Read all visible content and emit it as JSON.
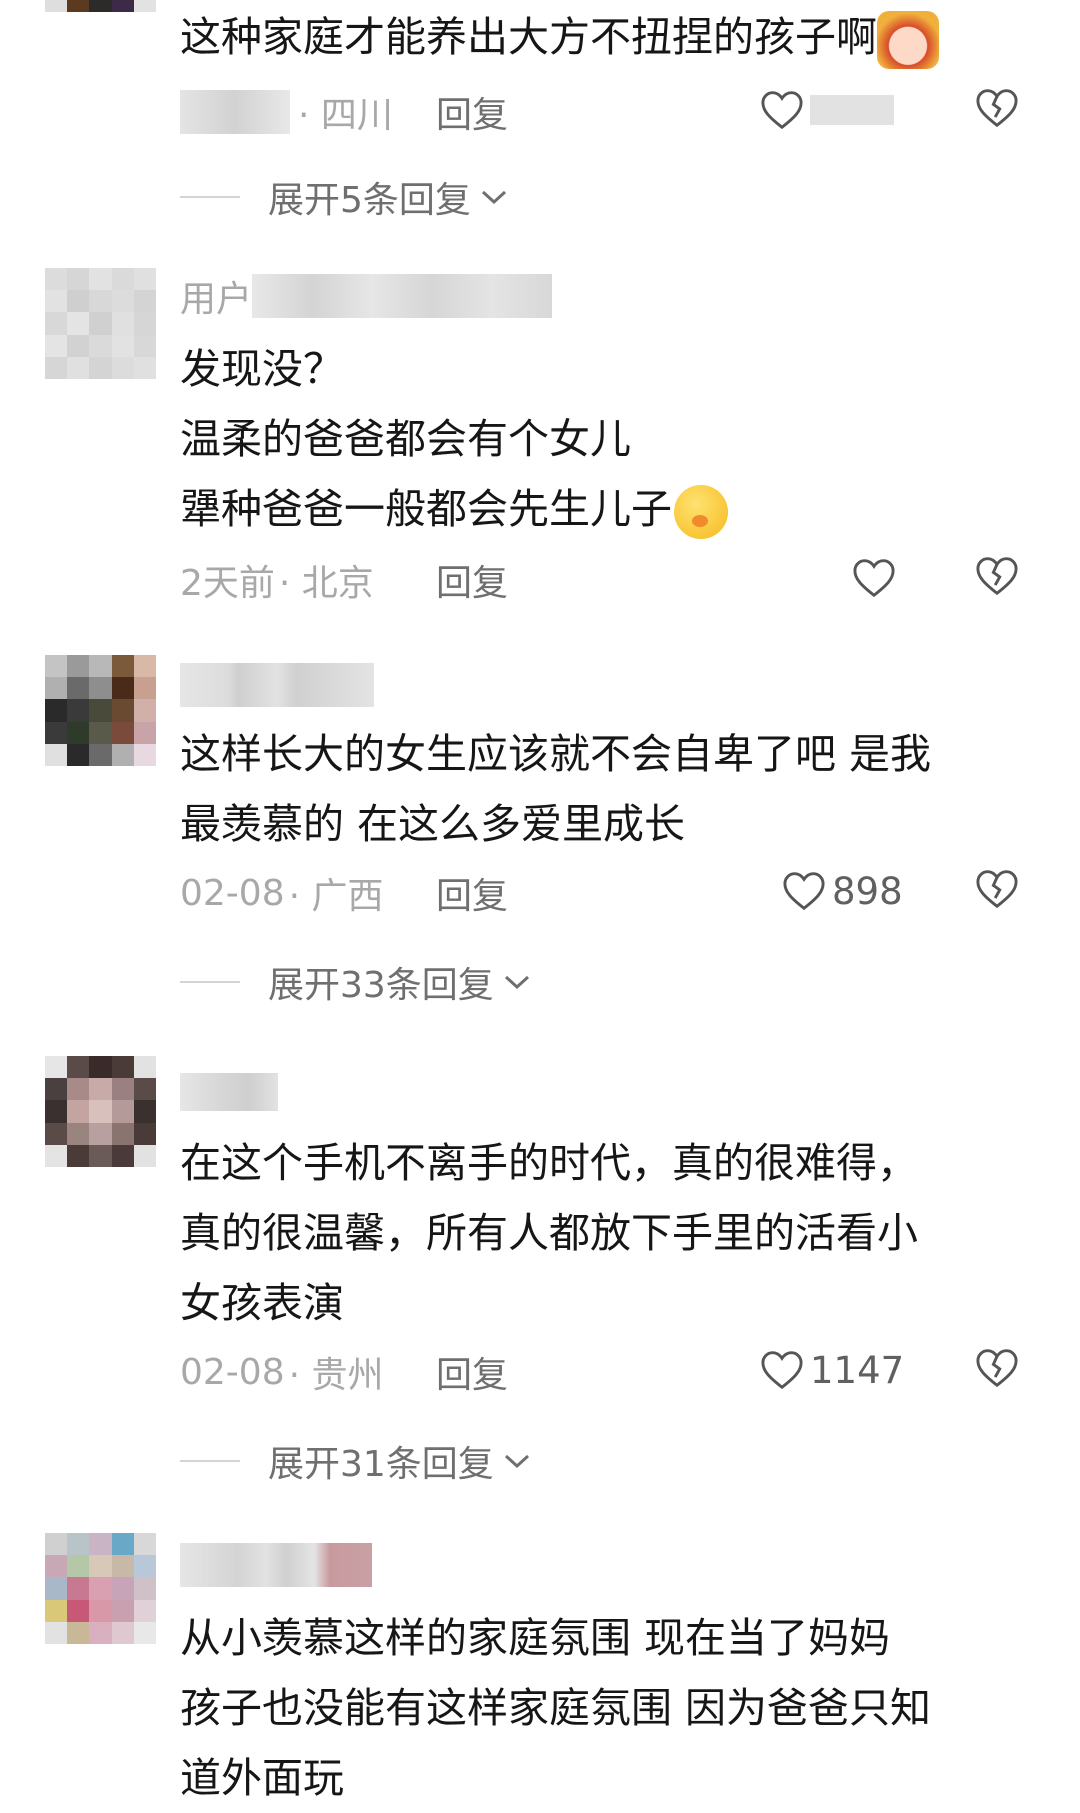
{
  "comments": [
    {
      "username": "",
      "text_lines": [
        "这种家庭才能养出大方不扭捏的孩子啊"
      ],
      "trailing_emoji": "sticker-icon",
      "time": "",
      "location": "· 四川",
      "reply_label": "回复",
      "like_count": "",
      "expand_label": "展开5条回复"
    },
    {
      "username": "用户",
      "text_lines": [
        "发现没？",
        "温柔的爸爸都会有个女儿",
        "犟种爸爸一般都会先生儿子"
      ],
      "trailing_emoji": "hand-over-mouth-emoji-icon",
      "time": "2天前",
      "location": "· 北京",
      "reply_label": "回复",
      "like_count": ""
    },
    {
      "username": "",
      "text_lines": [
        "这样长大的女生应该就不会自卑了吧 是我",
        "最羡慕的 在这么多爱里成长"
      ],
      "time": "02-08",
      "location": "· 广西",
      "reply_label": "回复",
      "like_count": "898",
      "expand_label": "展开33条回复"
    },
    {
      "username": "",
      "text_lines": [
        "在这个手机不离手的时代，真的很难得，",
        "真的很温馨，所有人都放下手里的活看小",
        "女孩表演"
      ],
      "time": "02-08",
      "location": "· 贵州",
      "reply_label": "回复",
      "like_count": "1147",
      "expand_label": "展开31条回复"
    },
    {
      "username": "",
      "text_lines": [
        "从小羡慕这样的家庭氛围  现在当了妈妈",
        "孩子也没能有这样家庭氛围  因为爸爸只知",
        "道外面玩"
      ]
    }
  ],
  "colors": {
    "text": "#161616",
    "meta": "#a8a8a8",
    "reply": "#6f6f6f",
    "icon_stroke": "#555555",
    "blur_gray": "#e6e6e6"
  }
}
